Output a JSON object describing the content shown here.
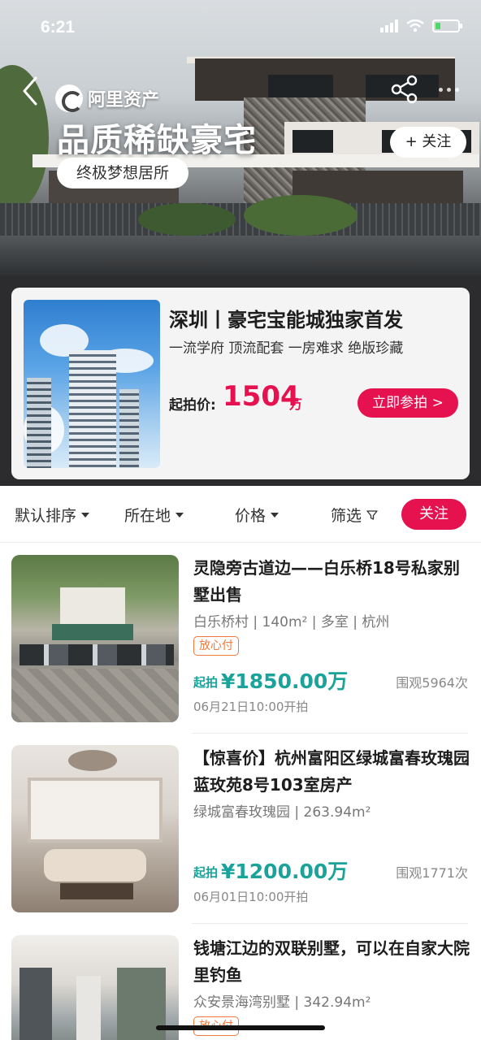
{
  "status_bar": {
    "time": "6:21"
  },
  "hero": {
    "brand": "阿里资产",
    "title": "品质稀缺豪宅",
    "chip": "终极梦想居所",
    "follow": "+ 关注"
  },
  "featured": {
    "title": "深圳丨豪宅宝能城独家首发",
    "subtitle": "一流学府 顶流配套 一房难求 绝版珍藏",
    "price_label": "起拍价:",
    "price": "1504",
    "price_unit": "万",
    "cta": "立即参拍 >"
  },
  "filters": {
    "sort": "默认排序",
    "location": "所在地",
    "price": "价格",
    "filter": "筛选",
    "follow": "关注"
  },
  "listings": [
    {
      "title": "灵隐旁古道边——白乐桥18号私家别墅出售",
      "meta": "白乐桥村 | 140m² | 多室 | 杭州",
      "badge": "放心付",
      "price_label": "起拍",
      "price": "¥1850.00",
      "price_unit": "万",
      "views": "围观5964次",
      "time": "06月21日10:00开拍"
    },
    {
      "title": "【惊喜价】杭州富阳区绿城富春玫瑰园蓝玫苑8号103室房产",
      "meta": "绿城富春玫瑰园 | 263.94m²",
      "price_label": "起拍",
      "price": "¥1200.00",
      "price_unit": "万",
      "views": "围观1771次",
      "time": "06月01日10:00开拍"
    },
    {
      "title": "钱塘江边的双联别墅，可以在自家大院里钓鱼",
      "meta": "众安景海湾别墅 | 342.94m²",
      "badge": "放心付"
    }
  ],
  "colors": {
    "accent": "#e6114f",
    "price": "#1aa39a",
    "badge": "#f07a3c"
  }
}
